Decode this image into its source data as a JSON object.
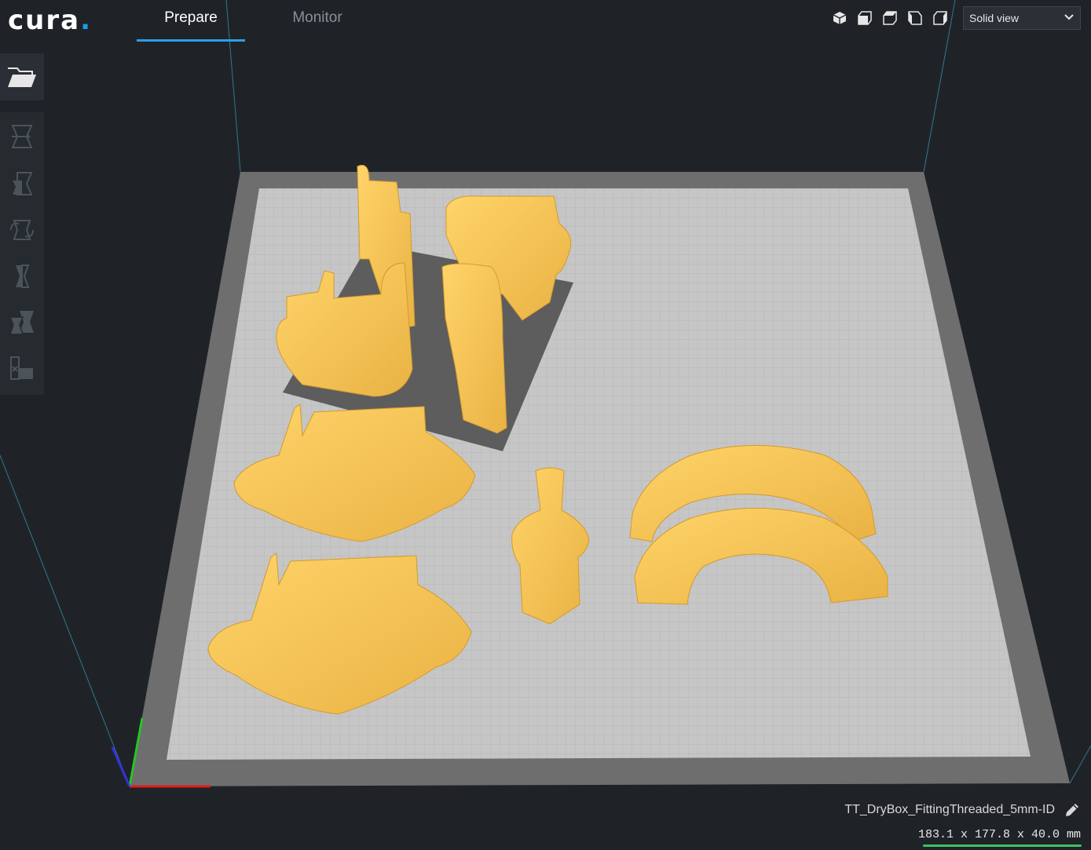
{
  "app": {
    "logo_text": "cura",
    "logo_dot": "."
  },
  "tabs": [
    {
      "label": "Prepare",
      "active": true
    },
    {
      "label": "Monitor",
      "active": false
    }
  ],
  "view": {
    "mode_label": "Solid view",
    "camera_icons": [
      "3d-view-icon",
      "front-view-icon",
      "top-view-icon",
      "left-view-icon",
      "right-view-icon"
    ]
  },
  "toolbar": {
    "open_icon": "folder-open-icon",
    "tools": [
      "move-tool-icon",
      "scale-tool-icon",
      "rotate-tool-icon",
      "mirror-tool-icon",
      "per-model-settings-icon",
      "support-blocker-icon"
    ]
  },
  "object": {
    "filename": "TT_DryBox_FittingThreaded_5mm-ID",
    "dimensions": "183.1 x 177.8 x 40.0 mm"
  },
  "colors": {
    "background": "#1f2327",
    "accent": "#2d9ee8",
    "model": "#ffc84f",
    "build_plate": "#c6c6c6",
    "dims_underline": "#3ec25e"
  }
}
